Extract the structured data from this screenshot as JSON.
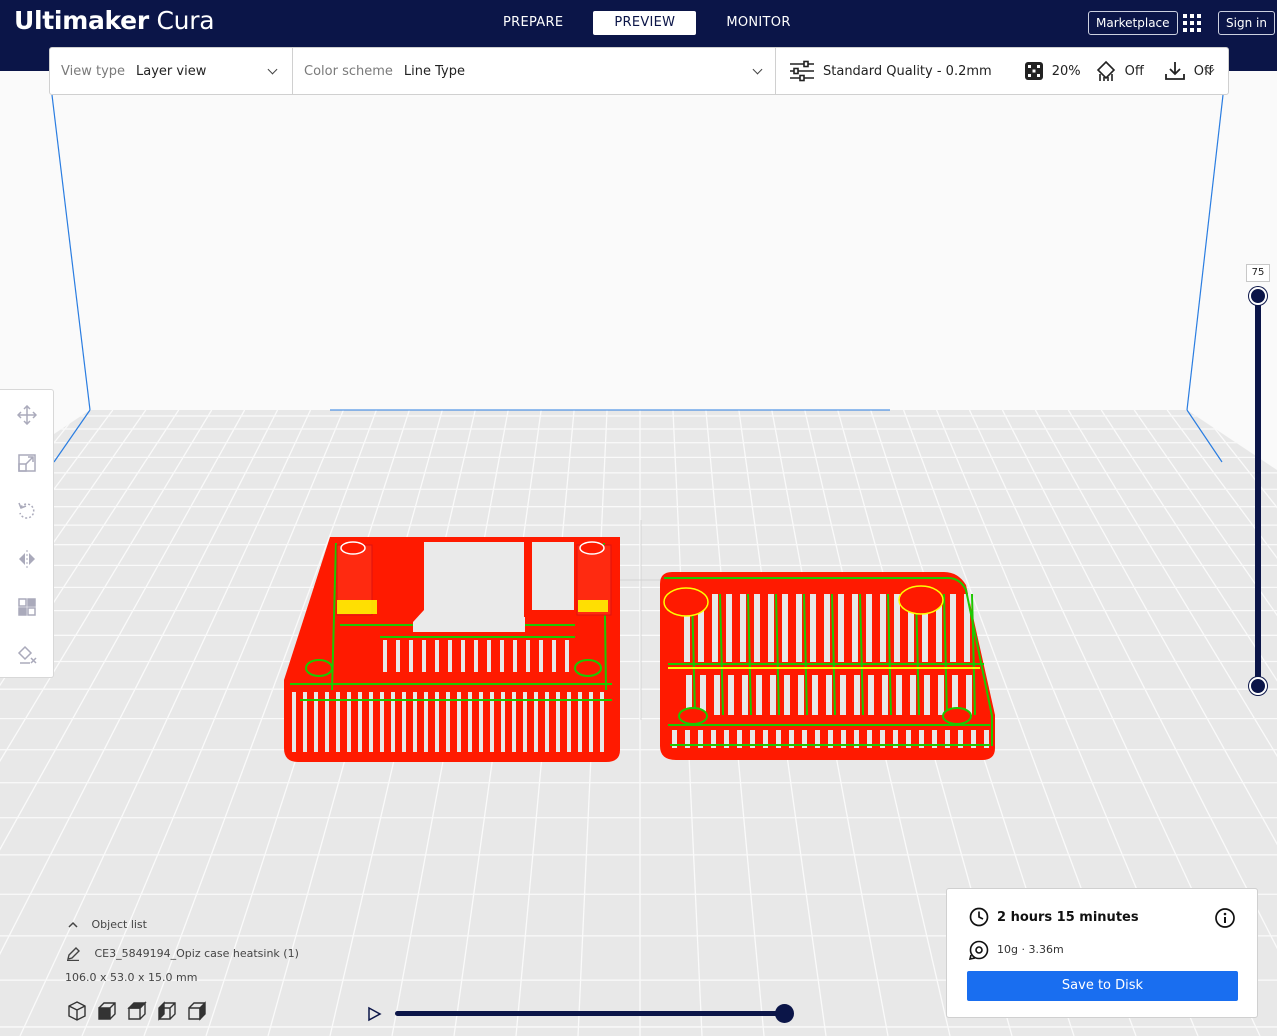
{
  "app": {
    "brand_bold": "Ultimaker",
    "brand_light": "Cura"
  },
  "stages": [
    {
      "label": "PREPARE"
    },
    {
      "label": "PREVIEW",
      "active": true
    },
    {
      "label": "MONITOR"
    }
  ],
  "header": {
    "marketplace_label": "Marketplace",
    "signin_label": "Sign in"
  },
  "topbar": {
    "view_type_label": "View type",
    "view_type_value": "Layer view",
    "color_scheme_label": "Color scheme",
    "color_scheme_value": "Line Type",
    "quality": "Standard Quality - 0.2mm",
    "infill": "20%",
    "support": "Off",
    "adhesion": "Off"
  },
  "tools": [
    {
      "name": "move-tool",
      "icon": "move-icon"
    },
    {
      "name": "scale-tool",
      "icon": "scale-icon"
    },
    {
      "name": "rotate-tool",
      "icon": "rotate-icon"
    },
    {
      "name": "mirror-tool",
      "icon": "mirror-icon"
    },
    {
      "name": "per-model-settings-tool",
      "icon": "per-model-settings-icon"
    },
    {
      "name": "support-blocker-tool",
      "icon": "support-blocker-icon"
    }
  ],
  "layer_slider": {
    "current_layer": "75",
    "upper_level": 1.0,
    "lower_level": 0.0
  },
  "path_slider": {
    "position": 1.0
  },
  "object_list": {
    "title": "Object list",
    "object_name": "CE3_5849194_Opiz case heatsink (1)",
    "dimensions": "106.0 x 53.0 x 15.0 mm"
  },
  "print_info": {
    "time": "2 hours 15 minutes",
    "material": "10g · 3.36m",
    "save_label": "Save to Disk"
  },
  "colors": {
    "header_bg": "#0b1548",
    "accent_blue": "#196ef0",
    "model_red": "#ff1a00",
    "infill_green": "#1ec800",
    "skin_yellow": "#ffff00",
    "buildvolume_edge": "#2a7de1"
  }
}
